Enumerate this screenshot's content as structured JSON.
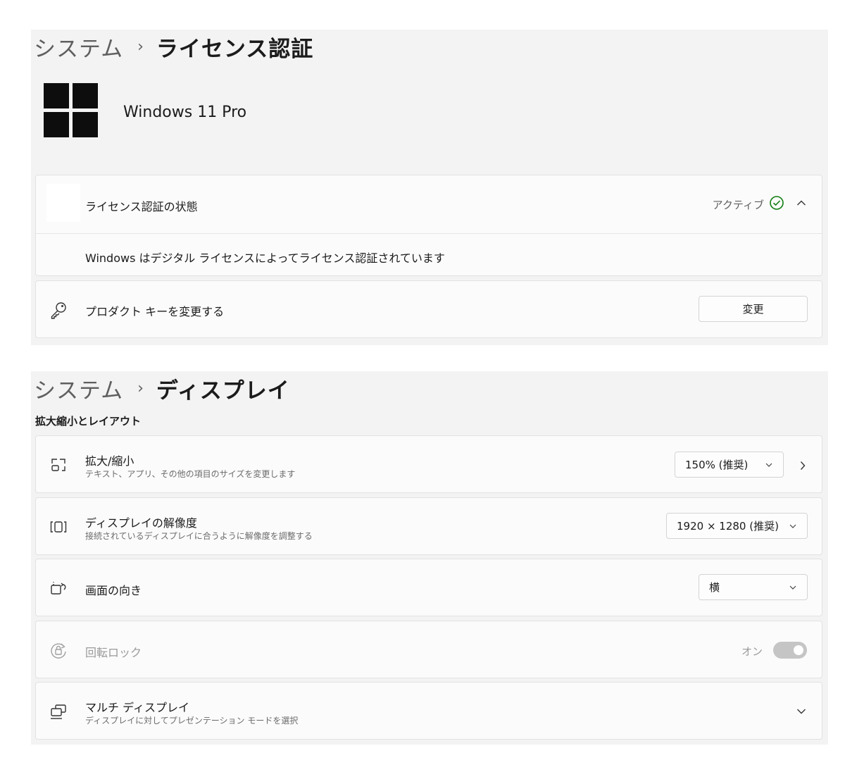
{
  "license_page": {
    "breadcrumb_root": "システム",
    "breadcrumb_separator": "›",
    "breadcrumb_current": "ライセンス認証",
    "product_name": "Windows 11 Pro",
    "activation": {
      "label": "ライセンス認証の状態",
      "status": "アクティブ",
      "status_color": "#107c10",
      "status_icon": "check-circle-icon",
      "expand_icon": "chevron-up-icon",
      "detail": "Windows はデジタル ライセンスによってライセンス認証されています"
    },
    "product_key": {
      "icon": "key-icon",
      "label": "プロダクト キーを変更する",
      "button_label": "変更"
    }
  },
  "display_page": {
    "breadcrumb_root": "システム",
    "breadcrumb_separator": "›",
    "breadcrumb_current": "ディスプレイ",
    "section_title": "拡大縮小とレイアウト",
    "scale": {
      "icon": "scale-icon",
      "title": "拡大/縮小",
      "subtitle": "テキスト、アプリ、その他の項目のサイズを変更します",
      "value": "150% (推奨)"
    },
    "resolution": {
      "icon": "resolution-icon",
      "title": "ディスプレイの解像度",
      "subtitle": "接続されているディスプレイに合うように解像度を調整する",
      "value": "1920 × 1280 (推奨)"
    },
    "orientation": {
      "icon": "orientation-icon",
      "title": "画面の向き",
      "value": "横"
    },
    "rotation_lock": {
      "icon": "rotation-lock-icon",
      "title": "回転ロック",
      "state_label": "オン",
      "state": true,
      "disabled": true
    },
    "multi_display": {
      "icon": "multi-display-icon",
      "title": "マルチ ディスプレイ",
      "subtitle": "ディスプレイに対してプレゼンテーション モードを選択"
    }
  }
}
